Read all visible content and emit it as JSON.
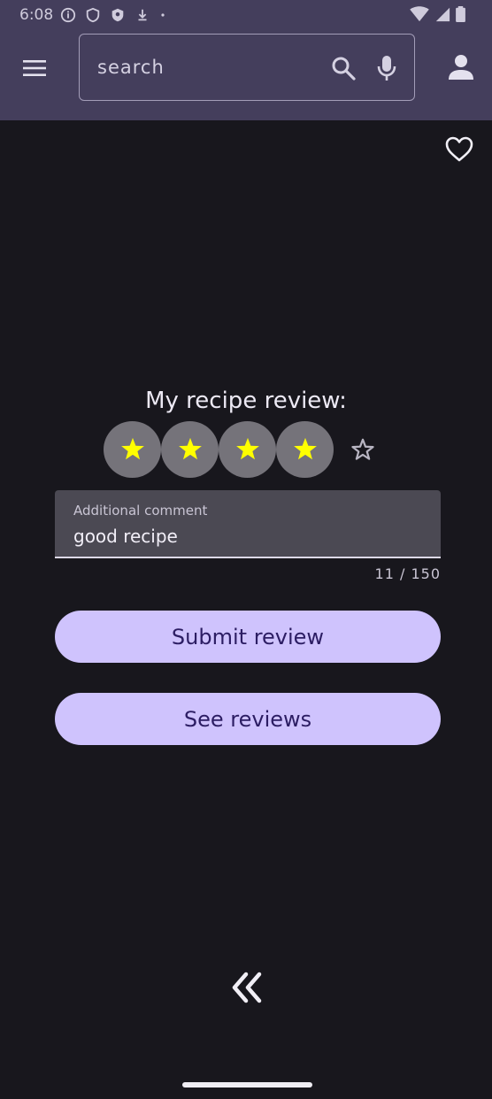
{
  "status_bar": {
    "time": "6:08"
  },
  "search": {
    "placeholder": "search",
    "value": ""
  },
  "icons": {
    "menu": "menu-icon",
    "search": "search-icon",
    "mic": "mic-icon",
    "profile": "profile-icon",
    "favorite": "heart-icon",
    "back": "double-chevron-left-icon"
  },
  "review": {
    "title": "My recipe review:",
    "rating": 4,
    "max_rating": 5,
    "comment_label": "Additional comment",
    "comment_value": "good recipe",
    "counter": "11 / 150"
  },
  "buttons": {
    "submit": "Submit review",
    "see_reviews": "See reviews"
  },
  "colors": {
    "top_bar": "#443e5c",
    "background": "#18171d",
    "button": "#cfc3fd",
    "button_text": "#2c1d63",
    "star_filled": "#ffff00"
  }
}
